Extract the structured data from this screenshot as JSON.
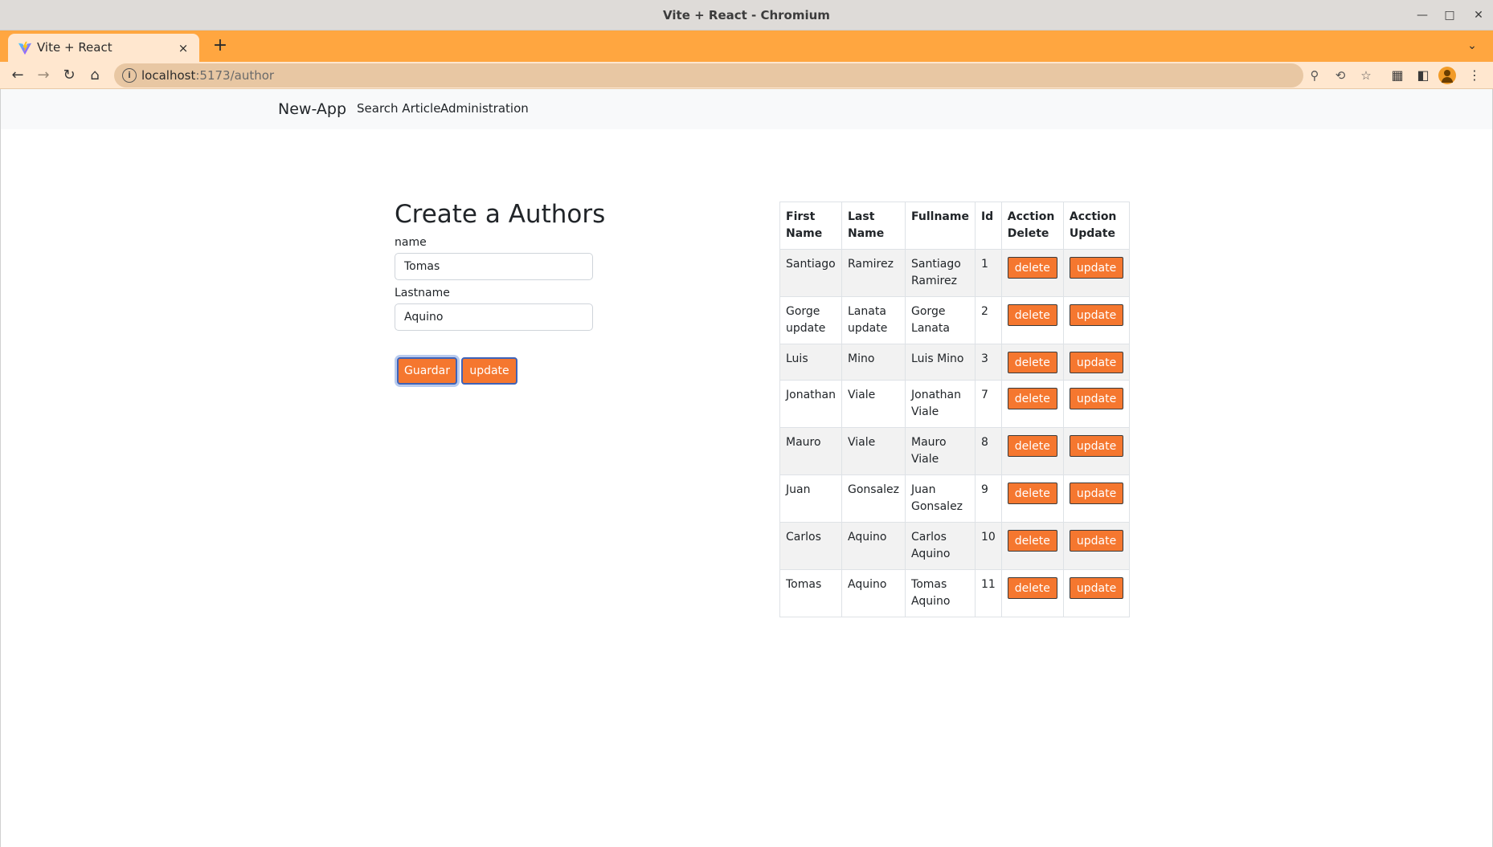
{
  "window": {
    "title": "Vite + React - Chromium"
  },
  "tab": {
    "title": "Vite + React",
    "close_icon": "×"
  },
  "toolbar": {
    "url_host": "localhost",
    "url_rest": ":5173/author"
  },
  "navbar": {
    "brand": "New-App",
    "links": [
      "Search Article",
      "Administration"
    ]
  },
  "form": {
    "title": "Create a Authors",
    "name_label": "name",
    "name_value": "Tomas",
    "lastname_label": "Lastname",
    "lastname_value": "Aquino",
    "save_label": "Guardar",
    "update_label": "update"
  },
  "table": {
    "headers": [
      "First Name",
      "Last Name",
      "Fullname",
      "Id",
      "Acction Delete",
      "Acction Update"
    ],
    "delete_label": "delete",
    "update_label": "update",
    "rows": [
      {
        "first": "Santiago",
        "last": "Ramirez",
        "full": "Santiago Ramirez",
        "id": "1"
      },
      {
        "first": "Gorge update",
        "last": "Lanata update",
        "full": "Gorge Lanata",
        "id": "2"
      },
      {
        "first": "Luis",
        "last": "Mino",
        "full": "Luis Mino",
        "id": "3"
      },
      {
        "first": "Jonathan",
        "last": "Viale",
        "full": "Jonathan Viale",
        "id": "7"
      },
      {
        "first": "Mauro",
        "last": "Viale",
        "full": "Mauro Viale",
        "id": "8"
      },
      {
        "first": "Juan",
        "last": "Gonsalez",
        "full": "Juan Gonsalez",
        "id": "9"
      },
      {
        "first": "Carlos",
        "last": "Aquino",
        "full": "Carlos Aquino",
        "id": "10"
      },
      {
        "first": "Tomas",
        "last": "Aquino",
        "full": "Tomas Aquino",
        "id": "11"
      }
    ]
  },
  "colors": {
    "accent": "#f5772f",
    "tabstrip": "#ffa640",
    "toolbar": "#ffe7cf"
  }
}
